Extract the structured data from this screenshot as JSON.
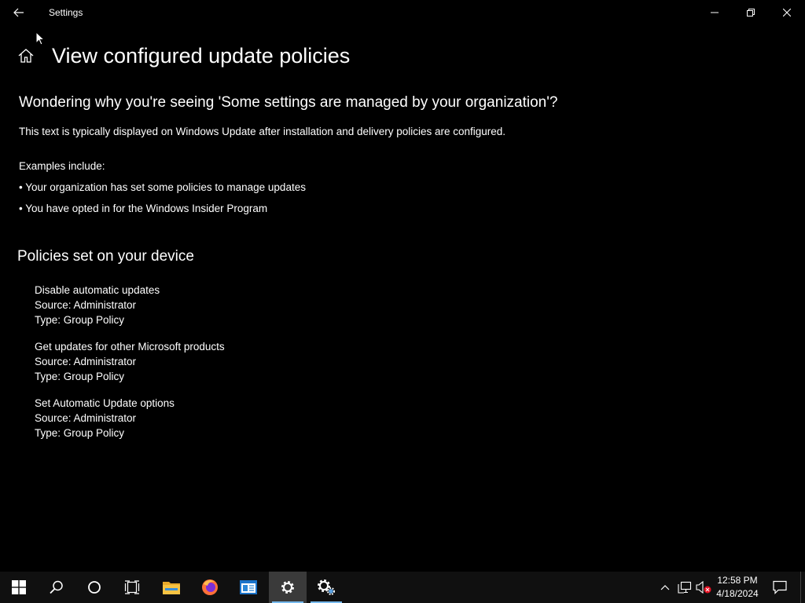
{
  "window": {
    "title": "Settings"
  },
  "page": {
    "title": "View configured update policies",
    "question": "Wondering why you're seeing 'Some settings are managed by your organization'?",
    "description": "This text is typically displayed on Windows Update after installation and delivery policies are configured.",
    "examples_label": "Examples include:",
    "examples": [
      "• Your organization has set some policies to manage updates",
      "• You have opted in for the Windows Insider Program"
    ],
    "policies_heading": "Policies set on your device",
    "policies": [
      {
        "name": "Disable automatic updates",
        "source": "Source: Administrator",
        "type": "Type: Group Policy"
      },
      {
        "name": "Get updates for other Microsoft products",
        "source": "Source: Administrator",
        "type": "Type: Group Policy"
      },
      {
        "name": "Set Automatic Update options",
        "source": "Source: Administrator",
        "type": "Type: Group Policy"
      }
    ]
  },
  "taskbar": {
    "clock_time": "12:58 PM",
    "clock_date": "4/18/2024",
    "accent_color": "#76b9ed",
    "icons": [
      "windows-start-icon",
      "search-icon",
      "cortana-icon",
      "task-view-icon",
      "file-explorer-icon",
      "firefox-icon",
      "app-window-icon",
      "settings-gear-icon",
      "settings-gear-icon"
    ]
  }
}
